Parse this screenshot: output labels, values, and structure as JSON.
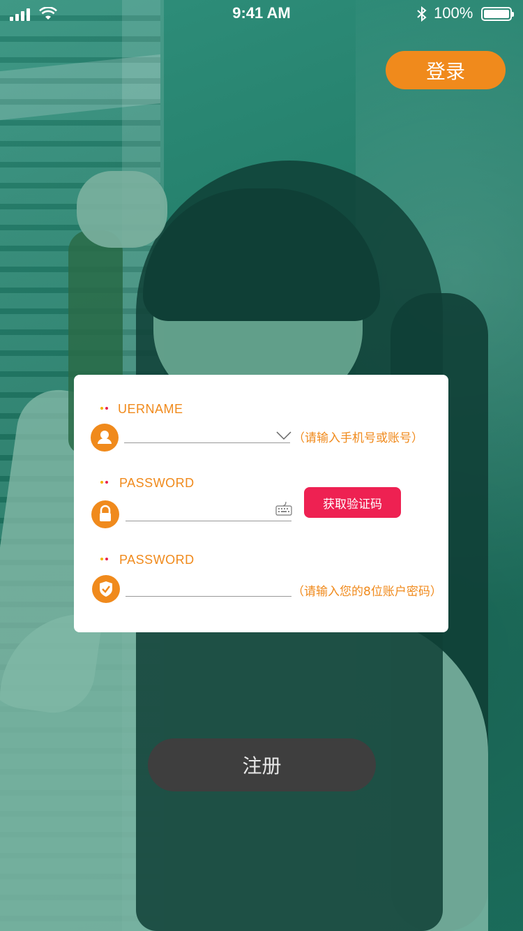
{
  "status_bar": {
    "time": "9:41 AM",
    "battery_percent": "100%",
    "battery_level": 1.0,
    "bluetooth_glyph": "✱"
  },
  "header": {
    "login_label": "登录"
  },
  "form": {
    "username": {
      "label": "UERNAME",
      "icon": "user-icon",
      "value": "",
      "hint": "（请输入手机号或账号）",
      "dropdown_icon": "chevron-down-icon"
    },
    "password": {
      "label": "PASSWORD",
      "icon": "lock-icon",
      "value": "",
      "keyboard_icon": "keyboard-icon",
      "get_code_label": "获取验证码"
    },
    "verify": {
      "label": "PASSWORD",
      "icon": "shield-check-icon",
      "value": "",
      "hint": "（请输入您的8位账户密码）"
    }
  },
  "footer": {
    "register_label": "注册"
  },
  "colors": {
    "accent": "#f08a1c",
    "code_button": "#ee2152",
    "register_button": "#3e3e3e",
    "overlay": "#1f7f6c"
  }
}
